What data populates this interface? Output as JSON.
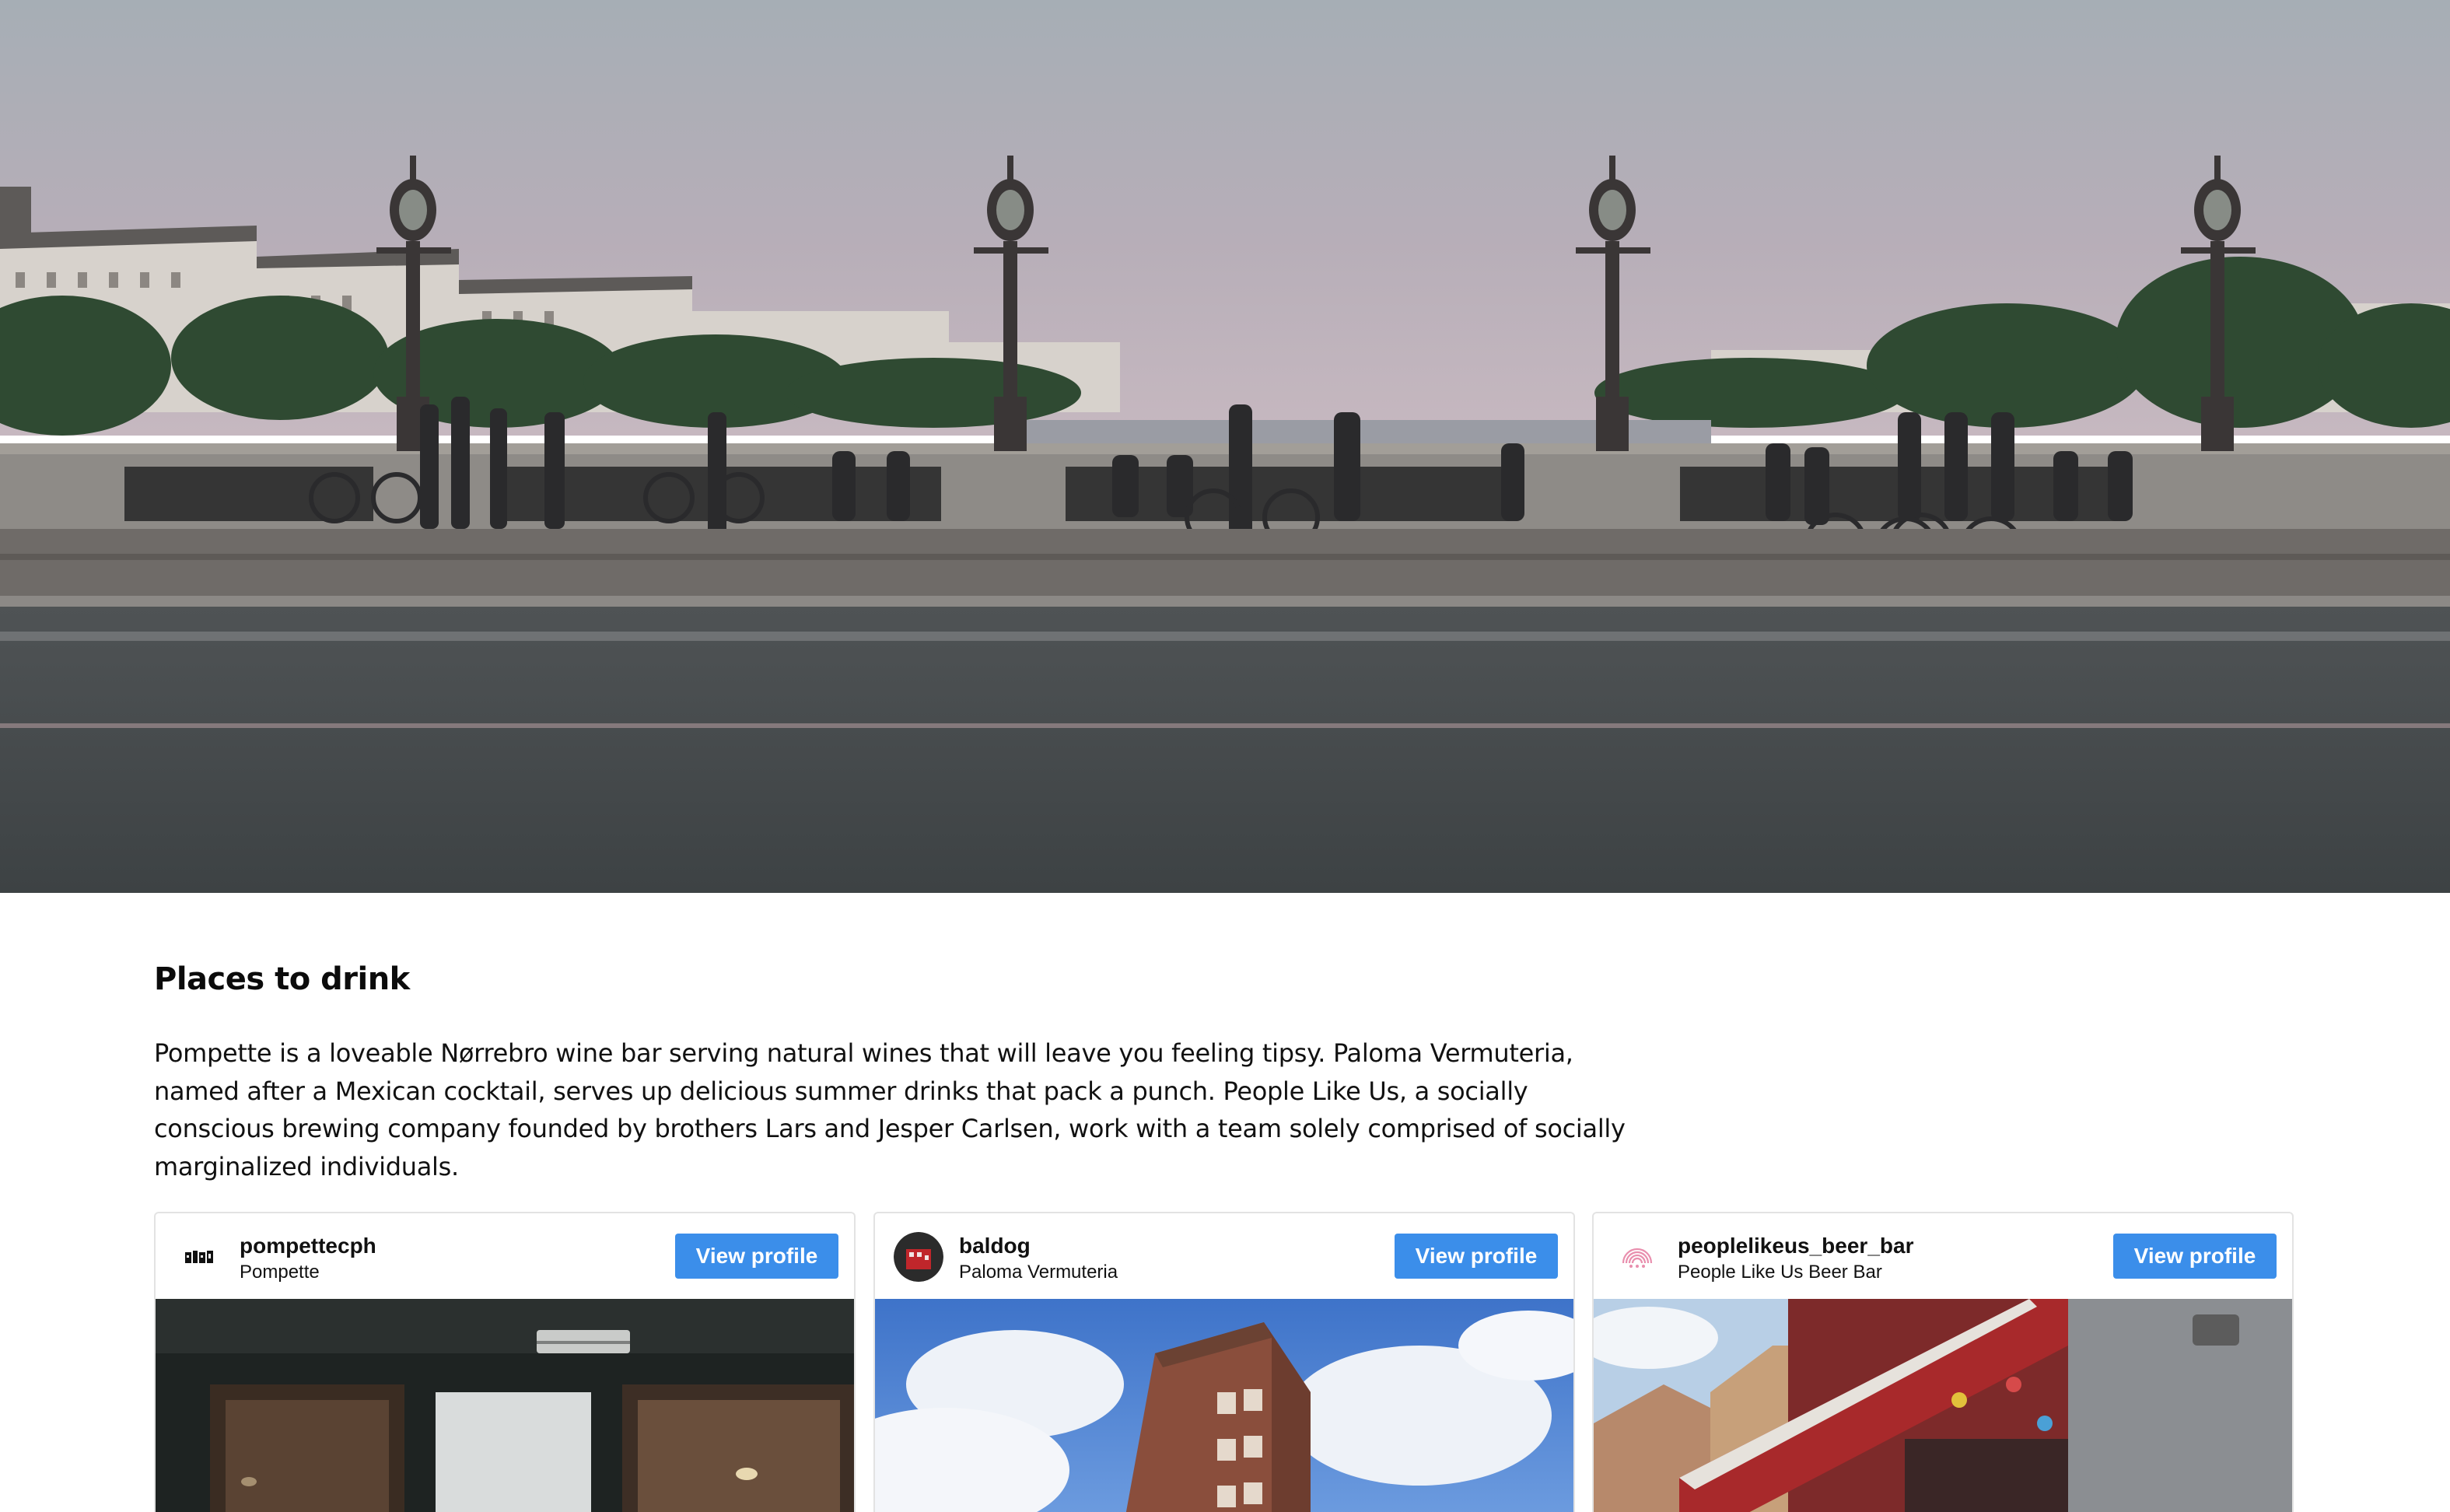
{
  "hero": {
    "image_description_icon": "hero-photo"
  },
  "section": {
    "title": "Places to drink",
    "body": "Pompette is a loveable Nørrebro wine bar serving natural wines that will leave you feeling tipsy. Paloma Vermuteria, named after a Mexican cocktail, serves up delicious summer drinks that pack a punch. People Like Us, a socially conscious brewing company founded by brothers Lars and Jesper Carlsen, work with a team solely comprised of socially marginalized individuals."
  },
  "cards": [
    {
      "username": "pompettecph",
      "name": "Pompette",
      "button": "View profile"
    },
    {
      "username": "baldog",
      "name": "Paloma Vermuteria",
      "button": "View profile"
    },
    {
      "username": "peoplelikeus_beer_bar",
      "name": "People Like Us Beer Bar",
      "button": "View profile"
    }
  ],
  "colors": {
    "button": "#3b8eea",
    "card_border": "#e3e3e3"
  }
}
